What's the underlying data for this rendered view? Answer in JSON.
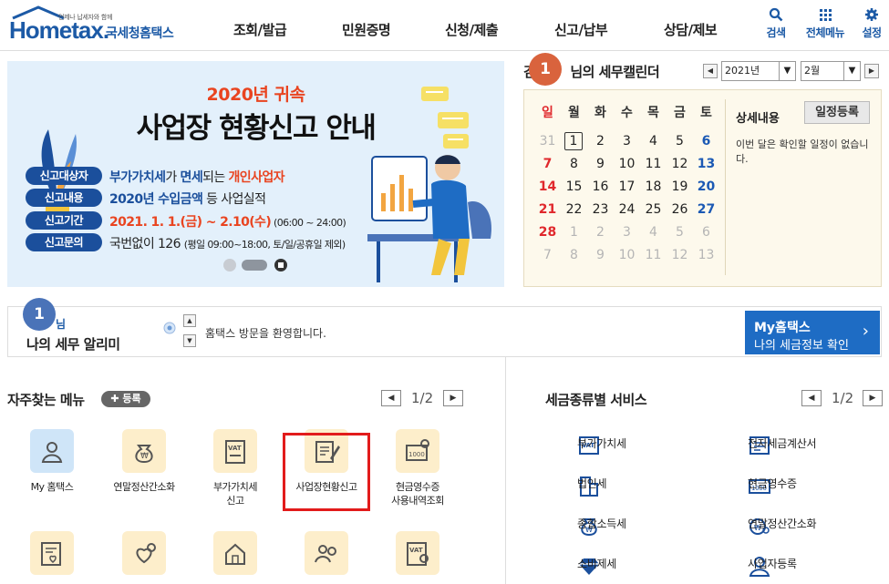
{
  "header": {
    "logo_small": "언제나 납세자와 함께",
    "logo_main": "Hometax.",
    "logo_sub": "국세청홈택스",
    "nav": [
      "조회/발급",
      "민원증명",
      "신청/제출",
      "신고/납부",
      "상담/제보"
    ],
    "utils": [
      {
        "label": "검색",
        "icon": "search-icon"
      },
      {
        "label": "전체메뉴",
        "icon": "grid-menu-icon"
      },
      {
        "label": "설정",
        "icon": "gear-icon"
      }
    ]
  },
  "banner": {
    "year": "2020년 귀속",
    "title": "사업장 현황신고 안내",
    "rows": [
      {
        "label": "신고대상자",
        "parts": [
          [
            "bl",
            "부가가치세"
          ],
          [
            "n",
            "가 "
          ],
          [
            "bl",
            "면세"
          ],
          [
            "n",
            "되는 "
          ],
          [
            "rd",
            "개인사업자"
          ]
        ]
      },
      {
        "label": "신고내용",
        "parts": [
          [
            "bl",
            "2020년 수입금액"
          ],
          [
            "n",
            " 등 사업실적"
          ]
        ]
      },
      {
        "label": "신고기간",
        "parts": [
          [
            "rd",
            "2021. 1. 1.(금) ~ 2.10(수)"
          ],
          [
            "sm",
            " (06:00 ~ 24:00)"
          ]
        ]
      },
      {
        "label": "신고문의",
        "parts": [
          [
            "n",
            "국번없이 126 "
          ],
          [
            "sm",
            "(평일 09:00~18:00, 토/일/공휴일 제외)"
          ]
        ]
      }
    ]
  },
  "calendar": {
    "title": "님의 세무캘린더",
    "title_prefix": "김",
    "badge": "1",
    "year": "2021년",
    "month": "2월",
    "weekdays": [
      "일",
      "월",
      "화",
      "수",
      "목",
      "금",
      "토"
    ],
    "weeks": [
      [
        "31",
        "1",
        "2",
        "3",
        "4",
        "5",
        "6"
      ],
      [
        "7",
        "8",
        "9",
        "10",
        "11",
        "12",
        "13"
      ],
      [
        "14",
        "15",
        "16",
        "17",
        "18",
        "19",
        "20"
      ],
      [
        "21",
        "22",
        "23",
        "24",
        "25",
        "26",
        "27"
      ],
      [
        "28",
        "1",
        "2",
        "3",
        "4",
        "5",
        "6"
      ],
      [
        "7",
        "8",
        "9",
        "10",
        "11",
        "12",
        "13"
      ]
    ],
    "today": "1",
    "detail_label": "상세내용",
    "add_label": "일정등록",
    "message": "이번 달은 확인할 일정이 없습니다.",
    "colors": {
      "sunday": "#e0282c",
      "saturday": "#1b59b4",
      "muted": "#b5b5b5",
      "normal": "#222222"
    }
  },
  "alert": {
    "badge": "1",
    "subtitle": "님",
    "title": "나의 세무 알리미",
    "message": "홈택스 방문을 환영합니다.",
    "my_title": "My홈택스",
    "my_sub": "나의 세금정보 확인"
  },
  "favorites": {
    "title": "자주찾는 메뉴",
    "register": "등록",
    "page": "1/2",
    "items": [
      {
        "label": "My 홈택스",
        "icon": "user-icon",
        "style": "blue"
      },
      {
        "label": "연말정산간소화",
        "icon": "money-bag-icon",
        "style": "yellow"
      },
      {
        "label": "부가가치세\n신고",
        "icon": "vat-document-icon",
        "style": "yellow"
      },
      {
        "label": "사업장현황신고",
        "icon": "edit-document-icon",
        "style": "yellow"
      },
      {
        "label": "현금영수증\n사용내역조회",
        "icon": "receipt-search-icon",
        "style": "yellow"
      },
      {
        "label": "",
        "icon": "document-heart-icon",
        "style": "yellow"
      },
      {
        "label": "",
        "icon": "heart-search-icon",
        "style": "yellow"
      },
      {
        "label": "",
        "icon": "house-document-icon",
        "style": "yellow"
      },
      {
        "label": "",
        "icon": "people-search-icon",
        "style": "yellow"
      },
      {
        "label": "",
        "icon": "vat-search-icon",
        "style": "yellow"
      }
    ]
  },
  "tax_services": {
    "title": "세금종류별 서비스",
    "page": "1/2",
    "items": [
      {
        "label": "부가가치세",
        "icon": "vat-icon"
      },
      {
        "label": "전자세금계산서",
        "icon": "invoice-icon"
      },
      {
        "label": "법인세",
        "icon": "building-icon"
      },
      {
        "label": "현금영수증",
        "icon": "cash-receipt-icon"
      },
      {
        "label": "종합소득세",
        "icon": "money-bag-icon"
      },
      {
        "label": "연말정산간소화",
        "icon": "coin-search-icon"
      },
      {
        "label": "소비제세",
        "icon": "diamond-icon"
      },
      {
        "label": "사업자등록",
        "icon": "person-register-icon"
      }
    ]
  }
}
